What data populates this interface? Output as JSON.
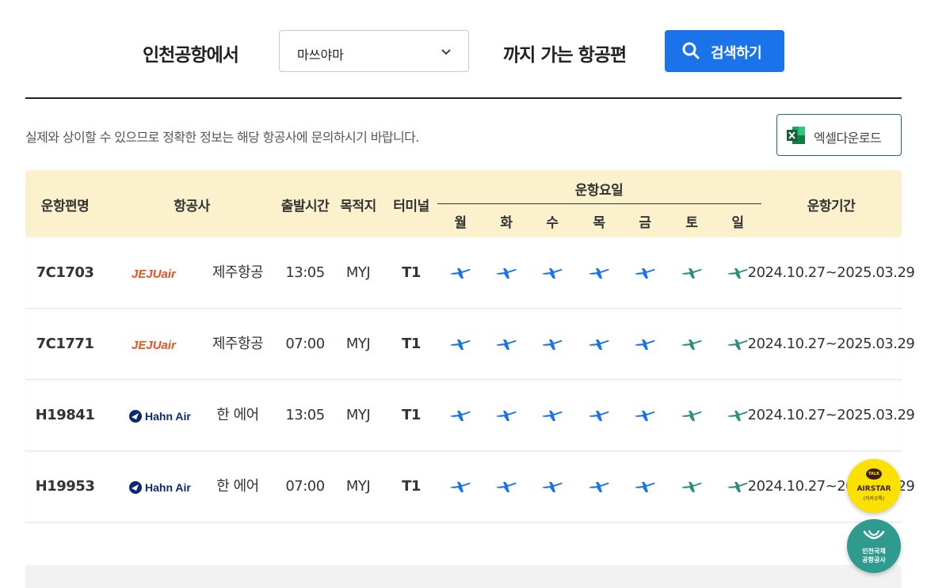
{
  "search": {
    "from_label": "인천공항에서",
    "destination_value": "마쓰야마",
    "to_label": "까지 가는 항공편",
    "search_button": "검색하기"
  },
  "notice": "실제와 상이할 수 있으므로 정확한 정보는 해당 항공사에 문의하시기 바랍니다.",
  "excel_button": "엑셀다운로드",
  "table": {
    "headers": {
      "flight": "운항편명",
      "airline": "항공사",
      "departure": "출발시간",
      "destination": "목적지",
      "terminal": "터미널",
      "days_group": "운항요일",
      "period": "운항기간"
    },
    "days": [
      "월",
      "화",
      "수",
      "목",
      "금",
      "토",
      "일"
    ],
    "rows": [
      {
        "flight": "7C1703",
        "airline_logo": "JEJUair",
        "airline": "제주항공",
        "time": "13:05",
        "dest": "MYJ",
        "terminal": "T1",
        "period": "2024.10.27~2025.03.29"
      },
      {
        "flight": "7C1771",
        "airline_logo": "JEJUair",
        "airline": "제주항공",
        "time": "07:00",
        "dest": "MYJ",
        "terminal": "T1",
        "period": "2024.10.27~2025.03.29"
      },
      {
        "flight": "H19841",
        "airline_logo": "Hahn Air",
        "airline": "한 에어",
        "time": "13:05",
        "dest": "MYJ",
        "terminal": "T1",
        "period": "2024.10.27~2025.03.29"
      },
      {
        "flight": "H19953",
        "airline_logo": "Hahn Air",
        "airline": "한 에어",
        "time": "07:00",
        "dest": "MYJ",
        "terminal": "T1",
        "period": "2024.10.27~2025.03.29"
      }
    ]
  },
  "floating": {
    "talk_badge": "TALK",
    "talk_title": "AIRSTAR",
    "talk_sub": "(카카오톡)",
    "home_line1": "인천국제",
    "home_line2": "공항공사"
  },
  "colors": {
    "accent": "#1a73e8",
    "header_bg": "#fbf2cd",
    "plane_weekday": "#1a73e8",
    "plane_weekend": "#2f8f7f",
    "jeju": "#e8531f",
    "hahn": "#0a2a73"
  }
}
